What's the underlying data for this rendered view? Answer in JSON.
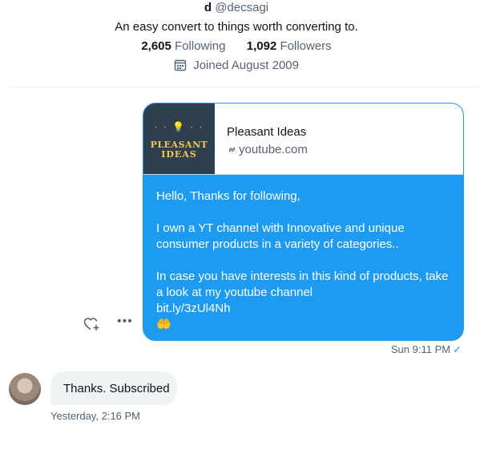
{
  "profile": {
    "name": "d",
    "handle": "@decsagi",
    "bio": "An easy convert to things worth converting to.",
    "following_count": "2,605",
    "following_label": "Following",
    "followers_count": "1,092",
    "followers_label": "Followers",
    "joined": "Joined August 2009"
  },
  "message": {
    "preview": {
      "title": "Pleasant Ideas",
      "domain": "youtube.com",
      "logo_line1": "PLEASANT",
      "logo_line2": "IDEAS"
    },
    "paragraphs": [
      "Hello, Thanks for following,",
      "I own a YT channel with Innovative and unique consumer products in a variety of categories..",
      "In case you have interests in this kind of products, take a look at my youtube channel"
    ],
    "link": "bit.ly/3zUl4Nh",
    "emoji": "🤲",
    "timestamp": "Sun 9:11 PM",
    "status_icon": "checkmark-icon"
  },
  "reply": {
    "text": "Thanks. Subscribed",
    "timestamp": "Yesterday, 2:16 PM"
  },
  "colors": {
    "accent": "#1d9bf0",
    "bubble_gray": "#eff3f4",
    "muted_text": "#536471"
  }
}
